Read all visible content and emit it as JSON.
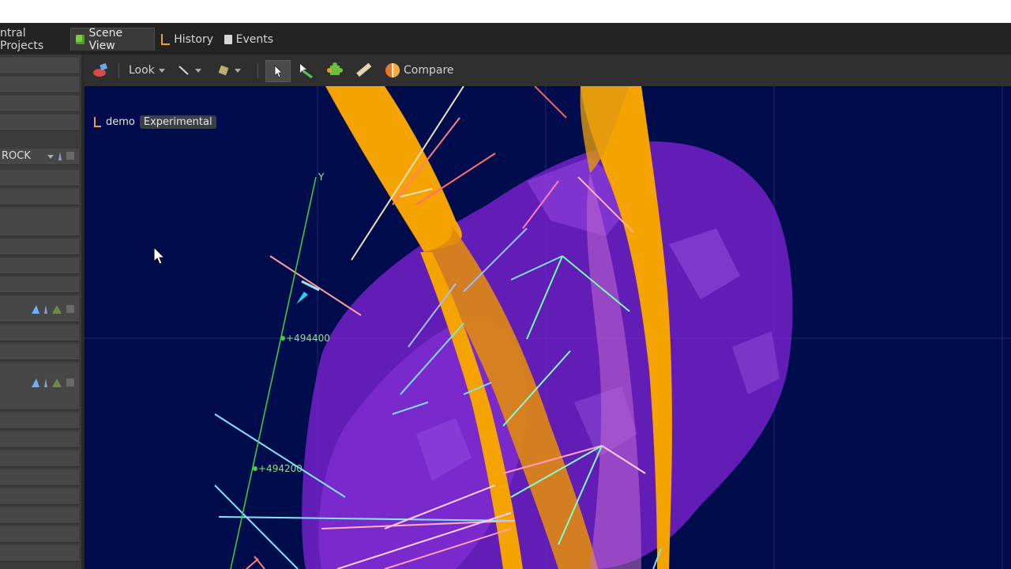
{
  "tabs": [
    {
      "label": "ntral Projects",
      "icon": "",
      "active": false
    },
    {
      "label": "Scene View",
      "icon": "cube-icon",
      "active": true
    },
    {
      "label": "History",
      "icon": "branch-icon",
      "active": false
    },
    {
      "label": "Events",
      "icon": "document-icon",
      "active": false
    }
  ],
  "sidebar": {
    "rock_label": "ROCK"
  },
  "toolbar": {
    "look_label": "Look",
    "compare_label": "Compare"
  },
  "viewport": {
    "project_name": "demo",
    "badge": "Experimental",
    "axis_label": "Y",
    "coord_upper": "+494400",
    "coord_lower": "+494200"
  },
  "colors": {
    "viewport_bg": "#000c4b",
    "ore_body": "#8a2be2",
    "fault": "#f5a300",
    "axis": "#3ed23e"
  }
}
